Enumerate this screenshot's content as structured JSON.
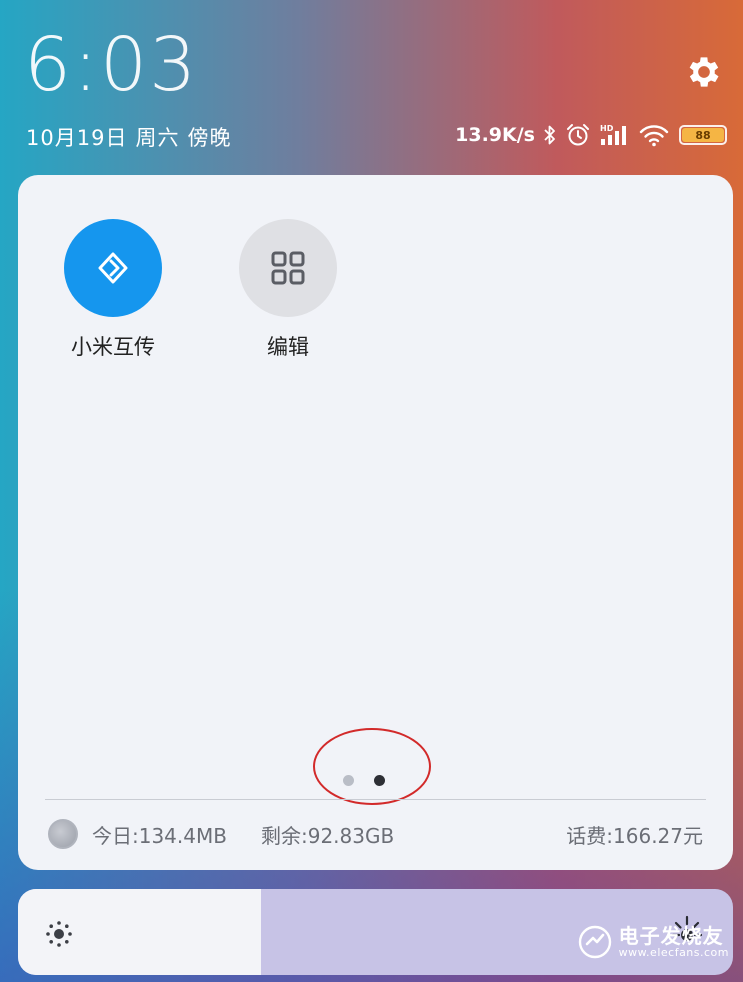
{
  "status": {
    "time": "6:03",
    "date": "10月19日",
    "weekday": "周六",
    "period": "傍晚",
    "net_speed": "13.9K/s",
    "battery_level": "88",
    "battery_color": "#f5b544"
  },
  "tiles": [
    {
      "label": "小米互传",
      "icon": "mi-transfer-icon",
      "color": "#1596ee"
    },
    {
      "label": "编辑",
      "icon": "grid-edit-icon",
      "color": "#dfe0e4"
    }
  ],
  "pager": {
    "page_count": 2,
    "current_page": 2
  },
  "usage": {
    "today": "今日:134.4MB",
    "remaining": "剩余:92.83GB",
    "balance": "话费:166.27元"
  },
  "brightness": {
    "level_fraction": 0.34
  },
  "watermark": {
    "brand_cn": "电子发烧友",
    "url": "www.elecfans.com"
  },
  "colors": {
    "accent": "#1596ee",
    "highlight_ring": "#d22a2a"
  }
}
